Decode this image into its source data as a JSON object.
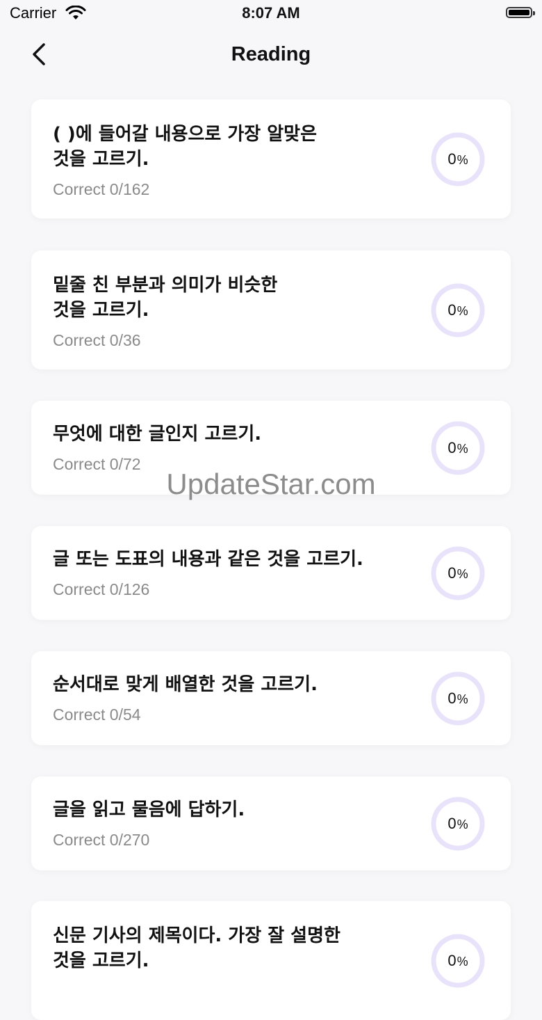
{
  "status_bar": {
    "carrier": "Carrier",
    "time": "8:07 AM"
  },
  "nav": {
    "title": "Reading"
  },
  "colors": {
    "ring": "#e8e3fb",
    "background": "#f7f7f9"
  },
  "items": [
    {
      "title": "(     )에 들어갈 내용으로 가장 알맞은\n것을 고르기.",
      "correct": "Correct 0/162",
      "percent_value": "0",
      "percent_sign": "%",
      "progress": 0
    },
    {
      "title": "밑줄 친 부분과 의미가 비슷한\n것을 고르기.",
      "correct": "Correct 0/36",
      "percent_value": "0",
      "percent_sign": "%",
      "progress": 0
    },
    {
      "title": "무엇에 대한 글인지 고르기.",
      "correct": "Correct 0/72",
      "percent_value": "0",
      "percent_sign": "%",
      "progress": 0
    },
    {
      "title": "글 또는 도표의 내용과 같은 것을 고르기.",
      "correct": "Correct 0/126",
      "percent_value": "0",
      "percent_sign": "%",
      "progress": 0
    },
    {
      "title": "순서대로 맞게 배열한 것을 고르기.",
      "correct": "Correct 0/54",
      "percent_value": "0",
      "percent_sign": "%",
      "progress": 0
    },
    {
      "title": "글을 읽고 물음에 답하기.",
      "correct": "Correct 0/270",
      "percent_value": "0",
      "percent_sign": "%",
      "progress": 0
    },
    {
      "title": "신문 기사의 제목이다. 가장 잘 설명한\n것을 고르기.",
      "correct": "",
      "percent_value": "0",
      "percent_sign": "%",
      "progress": 0
    }
  ],
  "watermark": "UpdateStar.com"
}
